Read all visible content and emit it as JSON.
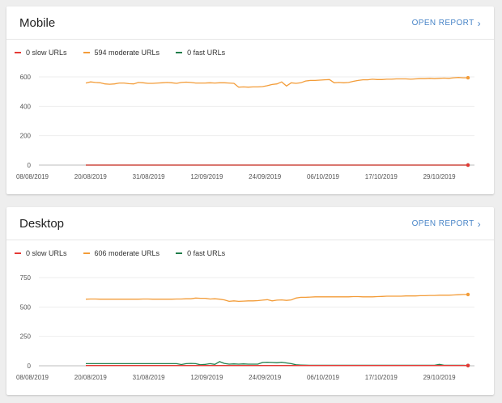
{
  "colors": {
    "slow": "#e53935",
    "moderate": "#f39c38",
    "fast": "#1e7d4a",
    "link": "#4a86c8"
  },
  "panels": [
    {
      "title": "Mobile",
      "open_report": "OPEN REPORT",
      "legend": {
        "slow": "0 slow URLs",
        "moderate": "594 moderate URLs",
        "fast": "0 fast URLs"
      }
    },
    {
      "title": "Desktop",
      "open_report": "OPEN REPORT",
      "legend": {
        "slow": "0 slow URLs",
        "moderate": "606 moderate URLs",
        "fast": "0 fast URLs"
      }
    }
  ],
  "chart_data": [
    {
      "type": "line",
      "x_tick_labels": [
        "08/08/2019",
        "20/08/2019",
        "31/08/2019",
        "12/09/2019",
        "24/09/2019",
        "06/10/2019",
        "17/10/2019",
        "29/10/2019"
      ],
      "y_ticks": [
        "0",
        "200",
        "400",
        "600"
      ],
      "ylim": [
        0,
        600
      ],
      "series": [
        {
          "name": "0 slow URLs",
          "key": "slow",
          "y": [
            0,
            0,
            0,
            0,
            0,
            0,
            0,
            0,
            0,
            0,
            0,
            0,
            0,
            0,
            0,
            0,
            0,
            0,
            0,
            0,
            0,
            0,
            0,
            0,
            0,
            0,
            0,
            0,
            0,
            0,
            0,
            0,
            0,
            0,
            0,
            0,
            0,
            0,
            0,
            0,
            0,
            0,
            0,
            0,
            0,
            0,
            0,
            0,
            0,
            0,
            0,
            0,
            0,
            0,
            0,
            0,
            0,
            0,
            0,
            0,
            0,
            0,
            0,
            0,
            0,
            0,
            0,
            0,
            0,
            0,
            0,
            0,
            0,
            0,
            0,
            0,
            0,
            0,
            0,
            0,
            0
          ]
        },
        {
          "name": "594 moderate URLs",
          "key": "moderate",
          "y": [
            558,
            566,
            562,
            560,
            552,
            550,
            552,
            558,
            558,
            554,
            552,
            562,
            560,
            556,
            556,
            558,
            560,
            562,
            560,
            556,
            562,
            564,
            562,
            558,
            558,
            558,
            560,
            558,
            560,
            560,
            558,
            556,
            530,
            532,
            530,
            532,
            532,
            534,
            540,
            548,
            552,
            566,
            538,
            560,
            556,
            560,
            572,
            576,
            576,
            578,
            580,
            582,
            560,
            562,
            560,
            562,
            570,
            576,
            580,
            580,
            584,
            582,
            582,
            584,
            584,
            586,
            586,
            586,
            584,
            586,
            588,
            588,
            590,
            588,
            590,
            592,
            590,
            594,
            596,
            594,
            594
          ]
        },
        {
          "name": "0 fast URLs",
          "key": "fast",
          "y": [
            0,
            0,
            0,
            0,
            0,
            0,
            0,
            0,
            0,
            0,
            0,
            0,
            0,
            0,
            0,
            0,
            0,
            0,
            0,
            0,
            0,
            0,
            0,
            0,
            0,
            0,
            0,
            0,
            0,
            0,
            0,
            0,
            0,
            0,
            0,
            0,
            0,
            0,
            0,
            0,
            0,
            0,
            0,
            0,
            0,
            0,
            0,
            0,
            0,
            0,
            0,
            0,
            0,
            0,
            0,
            0,
            0,
            0,
            0,
            0,
            0,
            0,
            0,
            0,
            0,
            0,
            0,
            0,
            0,
            0,
            0,
            0,
            0,
            0,
            0,
            0,
            0,
            0,
            0,
            0,
            0
          ]
        }
      ]
    },
    {
      "type": "line",
      "x_tick_labels": [
        "08/08/2019",
        "20/08/2019",
        "31/08/2019",
        "12/09/2019",
        "24/09/2019",
        "06/10/2019",
        "17/10/2019",
        "29/10/2019"
      ],
      "y_ticks": [
        "0",
        "250",
        "500",
        "750"
      ],
      "ylim": [
        0,
        750
      ],
      "series": [
        {
          "name": "0 slow URLs",
          "key": "slow",
          "y": [
            2,
            2,
            2,
            2,
            2,
            2,
            2,
            2,
            2,
            2,
            2,
            2,
            2,
            2,
            2,
            2,
            2,
            2,
            2,
            2,
            2,
            2,
            2,
            2,
            2,
            2,
            2,
            2,
            2,
            2,
            2,
            2,
            2,
            2,
            2,
            2,
            2,
            2,
            2,
            2,
            2,
            2,
            2,
            2,
            2,
            2,
            2,
            2,
            2,
            2,
            2,
            2,
            2,
            2,
            2,
            2,
            2,
            2,
            2,
            2,
            2,
            2,
            2,
            2,
            2,
            2,
            2,
            2,
            2,
            2,
            2,
            2,
            2,
            2,
            2,
            2,
            2,
            2,
            2,
            2,
            2
          ]
        },
        {
          "name": "606 moderate URLs",
          "key": "moderate",
          "y": [
            566,
            568,
            568,
            566,
            566,
            566,
            566,
            566,
            566,
            566,
            566,
            566,
            568,
            568,
            566,
            566,
            566,
            566,
            566,
            568,
            568,
            570,
            570,
            576,
            574,
            574,
            568,
            570,
            566,
            560,
            548,
            552,
            548,
            550,
            552,
            552,
            554,
            558,
            562,
            552,
            558,
            560,
            556,
            560,
            576,
            582,
            582,
            584,
            586,
            586,
            586,
            586,
            586,
            586,
            586,
            586,
            588,
            588,
            586,
            586,
            586,
            588,
            590,
            592,
            592,
            592,
            592,
            594,
            594,
            594,
            596,
            596,
            598,
            598,
            600,
            600,
            600,
            602,
            604,
            606,
            606
          ]
        },
        {
          "name": "0 fast URLs",
          "key": "fast",
          "y": [
            18,
            18,
            18,
            18,
            18,
            18,
            18,
            18,
            18,
            18,
            18,
            18,
            18,
            18,
            18,
            18,
            18,
            18,
            18,
            18,
            10,
            18,
            20,
            18,
            8,
            12,
            18,
            12,
            36,
            20,
            14,
            16,
            14,
            16,
            14,
            14,
            14,
            28,
            30,
            28,
            26,
            30,
            24,
            18,
            8,
            6,
            5,
            4,
            4,
            4,
            4,
            4,
            4,
            4,
            4,
            4,
            4,
            4,
            4,
            4,
            4,
            4,
            4,
            4,
            4,
            4,
            4,
            4,
            4,
            4,
            4,
            4,
            4,
            4,
            12,
            4,
            4,
            4,
            4,
            4,
            2
          ]
        }
      ]
    }
  ]
}
